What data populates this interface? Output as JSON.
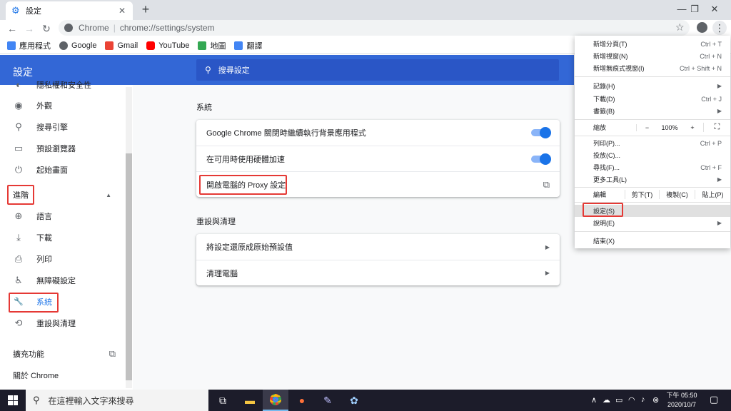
{
  "tab": {
    "title": "設定",
    "close": "✕",
    "new": "+"
  },
  "window": {
    "minimize": "—",
    "maximize": "❐",
    "close": "✕"
  },
  "omnibox": {
    "host": "Chrome",
    "separator": "|",
    "path": "chrome://settings/system"
  },
  "bookmarks": [
    {
      "label": "應用程式",
      "color": "#4285f4"
    },
    {
      "label": "Google",
      "color": "#5f6368"
    },
    {
      "label": "Gmail",
      "color": "#ea4335"
    },
    {
      "label": "YouTube",
      "color": "#ff0000"
    },
    {
      "label": "地圖",
      "color": "#34a853"
    },
    {
      "label": "翻譯",
      "color": "#4285f4"
    }
  ],
  "header": {
    "title": "設定",
    "search_placeholder": "搜尋設定"
  },
  "sidebar": {
    "items": [
      {
        "label": "隱私權和安全性",
        "icon": "shield-icon",
        "glyph": "◐"
      },
      {
        "label": "外觀",
        "icon": "palette-icon",
        "glyph": "◉"
      },
      {
        "label": "搜尋引擎",
        "icon": "search-icon",
        "glyph": "⚲"
      },
      {
        "label": "預設瀏覽器",
        "icon": "browser-icon",
        "glyph": "▭"
      },
      {
        "label": "起始畫面",
        "icon": "power-icon",
        "glyph": "⏻"
      }
    ],
    "advanced": "進階",
    "advanced_items": [
      {
        "label": "語言",
        "icon": "globe-icon",
        "glyph": "⊕"
      },
      {
        "label": "下載",
        "icon": "download-icon",
        "glyph": "⤓"
      },
      {
        "label": "列印",
        "icon": "print-icon",
        "glyph": "⎙"
      },
      {
        "label": "無障礙設定",
        "icon": "accessibility-icon",
        "glyph": "♿"
      },
      {
        "label": "系統",
        "icon": "wrench-icon",
        "glyph": "🔧"
      },
      {
        "label": "重設與清理",
        "icon": "restore-icon",
        "glyph": "⟲"
      }
    ],
    "extensions": "擴充功能",
    "about": "關於 Chrome"
  },
  "main": {
    "system_title": "系統",
    "system_rows": [
      {
        "label": "Google Chrome 關閉時繼續執行背景應用程式"
      },
      {
        "label": "在可用時使用硬體加速"
      },
      {
        "label": "開啟電腦的 Proxy 設定"
      }
    ],
    "reset_title": "重設與清理",
    "reset_rows": [
      {
        "label": "將設定還原成原始預設值"
      },
      {
        "label": "清理電腦"
      }
    ]
  },
  "menu": {
    "new_tab": "新增分頁(T)",
    "new_tab_s": "Ctrl + T",
    "new_window": "新增視窗(N)",
    "new_window_s": "Ctrl + N",
    "incognito": "新增無痕式視窗(I)",
    "incognito_s": "Ctrl + Shift + N",
    "history": "記錄(H)",
    "downloads": "下載(D)",
    "downloads_s": "Ctrl + J",
    "bookmarks": "書籤(B)",
    "zoom": "縮放",
    "zoom_minus": "−",
    "zoom_value": "100%",
    "zoom_plus": "+",
    "print": "列印(P)...",
    "print_s": "Ctrl + P",
    "cast": "投放(C)...",
    "find": "尋找(F)...",
    "find_s": "Ctrl + F",
    "more_tools": "更多工具(L)",
    "edit": "編輯",
    "cut": "剪下(T)",
    "copy": "複製(C)",
    "paste": "貼上(P)",
    "settings": "設定(S)",
    "help": "說明(E)",
    "exit": "結束(X)"
  },
  "taskbar": {
    "search_placeholder": "在這裡輸入文字來搜尋",
    "time": "下午 05:50",
    "date": "2020/10/7"
  }
}
